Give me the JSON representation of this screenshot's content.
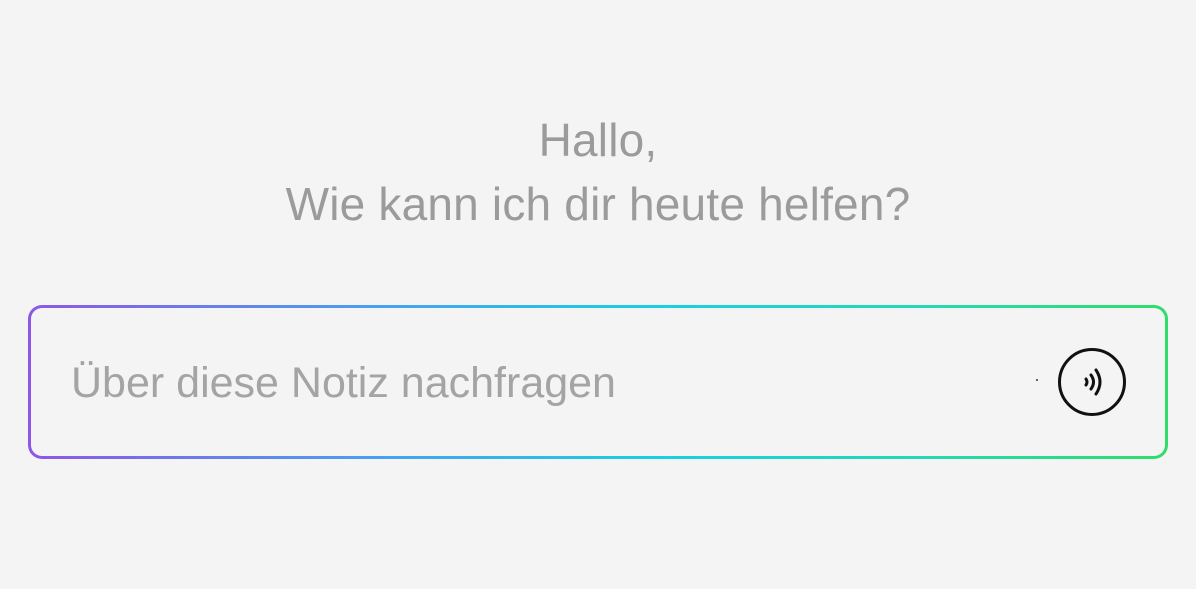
{
  "greeting": {
    "line1": "Hallo,",
    "line2": "Wie kann ich dir heute helfen?"
  },
  "prompt": {
    "placeholder": "Über diese Notiz nachfragen",
    "value": ""
  },
  "voice_button": {
    "icon": "sound-waves-icon"
  },
  "colors": {
    "background": "#f4f4f4",
    "text_muted": "#9b9b9b",
    "gradient_start": "#8e57e6",
    "gradient_mid": "#19cfe3",
    "gradient_end": "#2fde6a",
    "icon": "#111111"
  }
}
